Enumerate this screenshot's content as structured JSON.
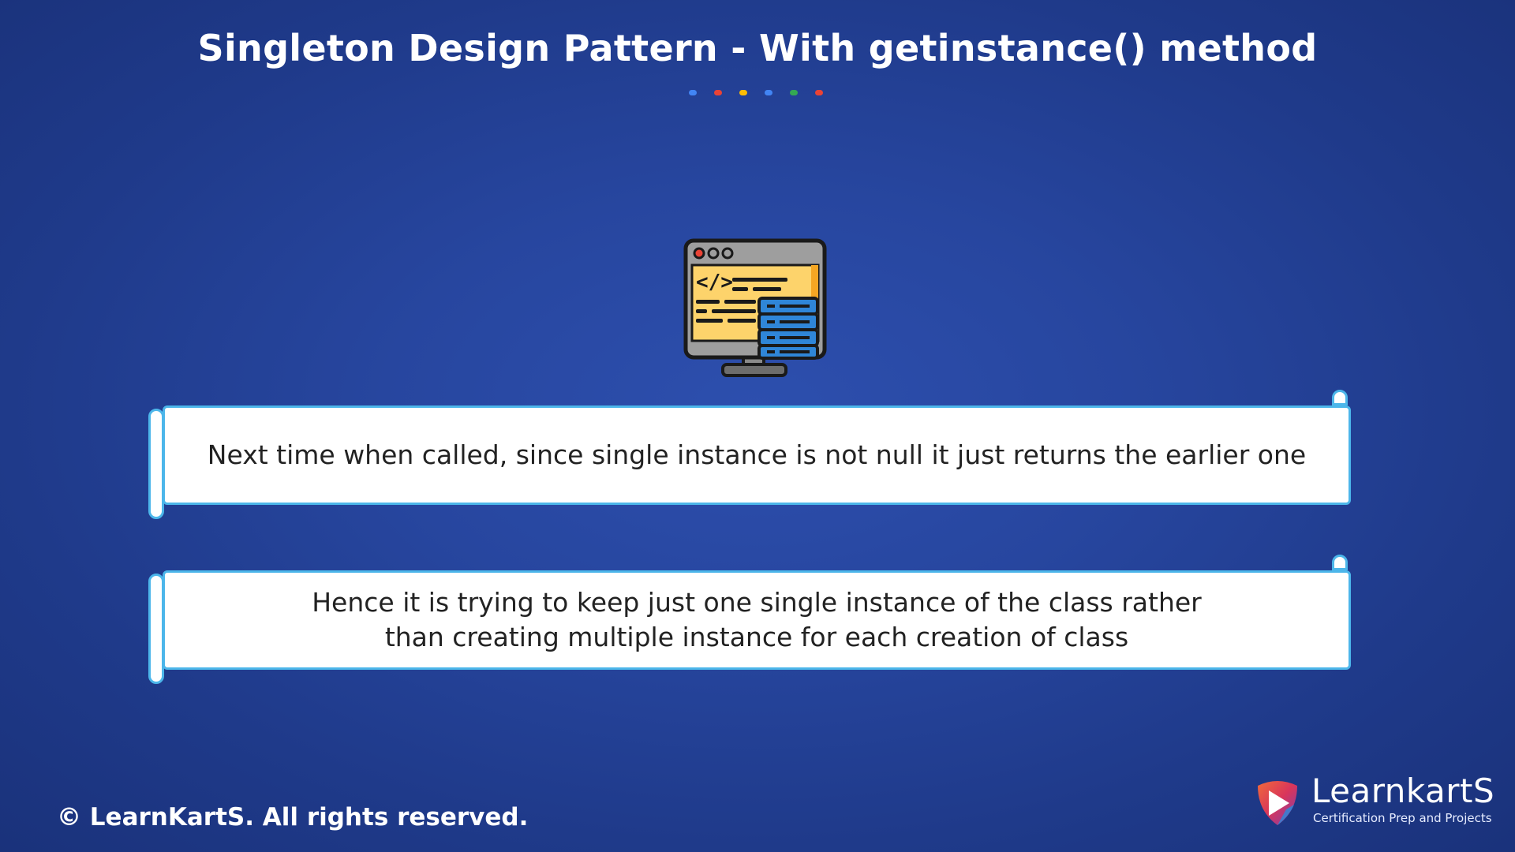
{
  "slide": {
    "title": "Singleton Design Pattern - With getinstance() method",
    "dot_colors": [
      "#4285f4",
      "#ea4335",
      "#fbbc05",
      "#4285f4",
      "#34a853",
      "#ea4335"
    ],
    "icon": "code-monitor-database-icon"
  },
  "points": [
    {
      "lines": [
        "Next time when called, since single instance is not null it just returns the earlier one"
      ]
    },
    {
      "lines": [
        "Hence it is trying to keep just one single instance of the class rather",
        "than creating multiple instance for each creation of class"
      ]
    }
  ],
  "footer": {
    "copyright": "© LearnKartS. All rights reserved."
  },
  "logo": {
    "name": "LearnkartS",
    "tagline": "Certification Prep and Projects",
    "icon": "learnkarts-play-shield-icon"
  },
  "colors": {
    "background": "#27469f",
    "scroll_border": "#4cb6ea",
    "screen": "#fdd36b",
    "database": "#2f86d8"
  }
}
